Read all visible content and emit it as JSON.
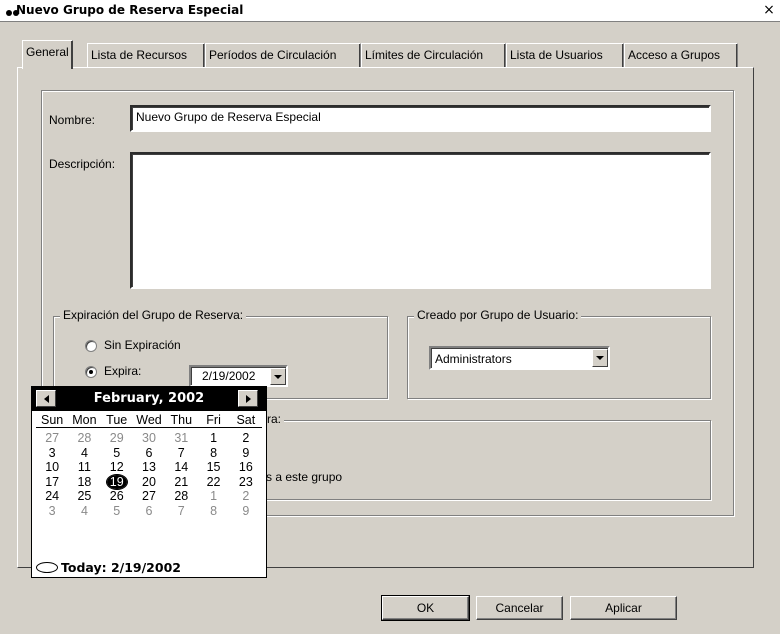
{
  "window": {
    "title": "Nuevo Grupo de Reserva Especial",
    "close_glyph": "×"
  },
  "tabs": [
    {
      "label": "General",
      "active": true
    },
    {
      "label": "Lista de Recursos",
      "active": false
    },
    {
      "label": "Períodos de Circulación",
      "active": false
    },
    {
      "label": "Límites de Circulación",
      "active": false
    },
    {
      "label": "Lista de Usuarios",
      "active": false
    },
    {
      "label": "Acceso a Grupos",
      "active": false
    }
  ],
  "form": {
    "name_label": "Nombre:",
    "name_value": "Nuevo Grupo de Reserva Especial",
    "description_label": "Descripción:",
    "description_value": ""
  },
  "expiration": {
    "legend": "Expiración del Grupo de Reserva:",
    "no_expiry_label": "Sin Expiración",
    "expires_label": "Expira:",
    "selected": "expires",
    "date_value": "2/19/2002"
  },
  "created_by": {
    "legend": "Creado por Grupo de Usuario:",
    "selected": "Administrators"
  },
  "hidden_group": {
    "legend_tail": "ra:",
    "text_tail": "s a este grupo"
  },
  "buttons": {
    "ok": "OK",
    "cancel": "Cancelar",
    "apply": "Aplicar"
  },
  "calendar": {
    "month_label": "February, 2002",
    "days_of_week": [
      "Sun",
      "Mon",
      "Tue",
      "Wed",
      "Thu",
      "Fri",
      "Sat"
    ],
    "weeks": [
      [
        {
          "d": "27",
          "dim": true
        },
        {
          "d": "28",
          "dim": true
        },
        {
          "d": "29",
          "dim": true
        },
        {
          "d": "30",
          "dim": true
        },
        {
          "d": "31",
          "dim": true
        },
        {
          "d": "1"
        },
        {
          "d": "2"
        }
      ],
      [
        {
          "d": "3"
        },
        {
          "d": "4"
        },
        {
          "d": "5"
        },
        {
          "d": "6"
        },
        {
          "d": "7"
        },
        {
          "d": "8"
        },
        {
          "d": "9"
        }
      ],
      [
        {
          "d": "10"
        },
        {
          "d": "11"
        },
        {
          "d": "12"
        },
        {
          "d": "13"
        },
        {
          "d": "14"
        },
        {
          "d": "15"
        },
        {
          "d": "16"
        }
      ],
      [
        {
          "d": "17"
        },
        {
          "d": "18"
        },
        {
          "d": "19",
          "selected": true
        },
        {
          "d": "20"
        },
        {
          "d": "21"
        },
        {
          "d": "22"
        },
        {
          "d": "23"
        }
      ],
      [
        {
          "d": "24"
        },
        {
          "d": "25"
        },
        {
          "d": "26"
        },
        {
          "d": "27"
        },
        {
          "d": "28"
        },
        {
          "d": "1",
          "dim": true
        },
        {
          "d": "2",
          "dim": true
        }
      ],
      [
        {
          "d": "3",
          "dim": true
        },
        {
          "d": "4",
          "dim": true
        },
        {
          "d": "5",
          "dim": true
        },
        {
          "d": "6",
          "dim": true
        },
        {
          "d": "7",
          "dim": true
        },
        {
          "d": "8",
          "dim": true
        },
        {
          "d": "9",
          "dim": true
        }
      ]
    ],
    "today_label": "Today: 2/19/2002"
  }
}
